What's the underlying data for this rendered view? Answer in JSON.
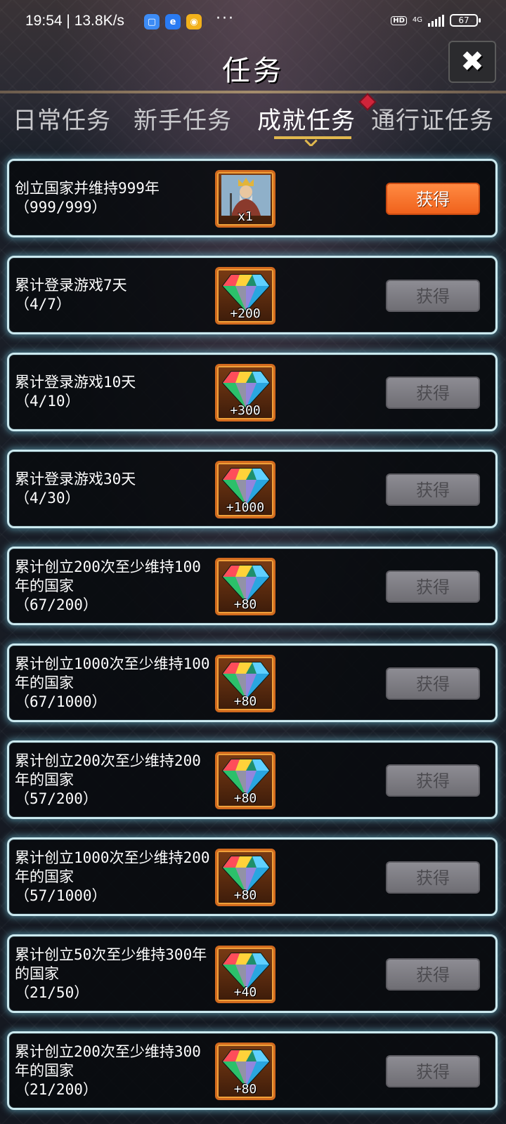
{
  "status_bar": {
    "time": "19:54",
    "speed": "| 13.8K/s",
    "more": "···",
    "hd": "HD",
    "network": "4G",
    "battery": "67"
  },
  "header": {
    "title": "任务",
    "close_icon": "✖"
  },
  "tabs": [
    {
      "label": "日常任务",
      "active": false
    },
    {
      "label": "新手任务",
      "active": false
    },
    {
      "label": "成就任务",
      "active": true
    },
    {
      "label": "通行证任务",
      "active": false
    }
  ],
  "tasks": [
    {
      "name": "创立国家并维持999年",
      "progress": "（999/999）",
      "reward_icon": "king-portrait-icon",
      "reward_amount": "x1",
      "button": "获得",
      "claimable": true
    },
    {
      "name": "累计登录游戏7天",
      "progress": "（4/7）",
      "reward_icon": "gem-icon",
      "reward_amount": "+200",
      "button": "获得",
      "claimable": false
    },
    {
      "name": "累计登录游戏10天",
      "progress": "（4/10）",
      "reward_icon": "gem-icon",
      "reward_amount": "+300",
      "button": "获得",
      "claimable": false
    },
    {
      "name": "累计登录游戏30天",
      "progress": "（4/30）",
      "reward_icon": "gem-icon",
      "reward_amount": "+1000",
      "button": "获得",
      "claimable": false
    },
    {
      "name": "累计创立200次至少维持100年的国家",
      "progress": "（67/200）",
      "reward_icon": "gem-icon",
      "reward_amount": "+80",
      "button": "获得",
      "claimable": false
    },
    {
      "name": "累计创立1000次至少维持100年的国家",
      "progress": "（67/1000）",
      "reward_icon": "gem-icon",
      "reward_amount": "+80",
      "button": "获得",
      "claimable": false
    },
    {
      "name": "累计创立200次至少维持200年的国家",
      "progress": "（57/200）",
      "reward_icon": "gem-icon",
      "reward_amount": "+80",
      "button": "获得",
      "claimable": false
    },
    {
      "name": "累计创立1000次至少维持200年的国家",
      "progress": "（57/1000）",
      "reward_icon": "gem-icon",
      "reward_amount": "+80",
      "button": "获得",
      "claimable": false
    },
    {
      "name": "累计创立50次至少维持300年的国家",
      "progress": "（21/50）",
      "reward_icon": "gem-icon",
      "reward_amount": "+40",
      "button": "获得",
      "claimable": false
    },
    {
      "name": "累计创立200次至少维持300年的国家",
      "progress": "（21/200）",
      "reward_icon": "gem-icon",
      "reward_amount": "+80",
      "button": "获得",
      "claimable": false
    }
  ],
  "colors": {
    "card_border": "#cbe9ef",
    "claim_enabled": "#f0621c",
    "claim_disabled": "#7c7b81",
    "tab_active_underline": "#e1b84e"
  }
}
